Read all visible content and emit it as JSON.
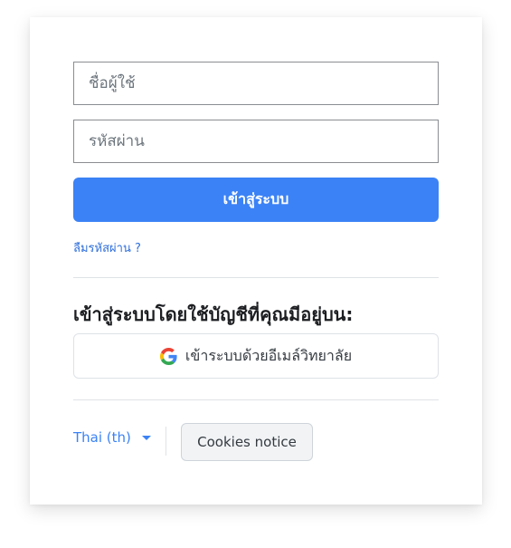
{
  "login_form": {
    "username_placeholder": "ชื่อผู้ใช้",
    "password_placeholder": "รหัสผ่าน",
    "username_value": "",
    "password_value": "",
    "submit_label": "เข้าสู่ระบบ",
    "forgot_password_label": "ลืมรหัสผ่าน ?"
  },
  "external_login": {
    "heading": "เข้าสู่ระบบโดยใช้บัญชีที่คุณมีอยู่บน:",
    "providers": [
      {
        "icon": "google-icon",
        "label": "เข้าระบบด้วยอีเมล์วิทยาลัย"
      }
    ]
  },
  "footer": {
    "language_label": "Thai ‎(th)‎",
    "cookies_label": "Cookies notice"
  },
  "colors": {
    "primary": "#3b82f6",
    "link": "#2f6fdb",
    "secondary_button_bg": "#f1f3f5"
  }
}
